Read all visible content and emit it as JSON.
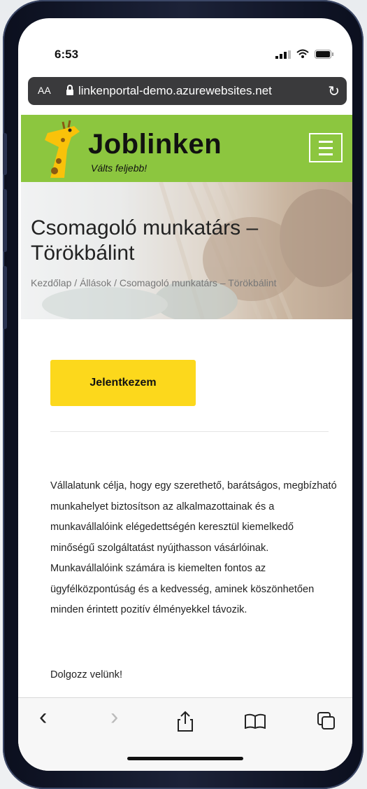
{
  "status": {
    "time": "6:53"
  },
  "browser": {
    "text_size_label": "AA",
    "url": "linkenportal-demo.azurewebsites.net"
  },
  "site": {
    "logo_title": "Joblinken",
    "logo_subtitle": "Válts feljebb!",
    "accent_color": "#8cc63f"
  },
  "page": {
    "title": "Csomagoló munkatárs – Törökbálint",
    "breadcrumb": [
      "Kezdőlap",
      "Állások",
      "Csomagoló munkatárs – Törökbálint"
    ],
    "breadcrumb_separator": "/"
  },
  "content": {
    "apply_label": "Jelentkezem",
    "apply_color": "#fcd81c",
    "description": "Vállalatunk célja, hogy egy szerethető, barátságos, megbízható munkahelyet biztosítson az alkalmazottainak és a munkavállalóink elégedettségén keresztül kiemelkedő minőségű szolgáltatást nyújthasson vásárlóinak. Munkavállalóink számára is kiemelten fontos az ügyfélközpontúság és a kedvesség, aminek köszönhetően minden érintett pozitív élményekkel távozik.",
    "cta": "Dolgozz velünk!"
  },
  "toolbar": {
    "back": "‹",
    "forward": "›",
    "icons": [
      "back-icon",
      "forward-icon",
      "share-icon",
      "bookmarks-icon",
      "tabs-icon"
    ]
  }
}
